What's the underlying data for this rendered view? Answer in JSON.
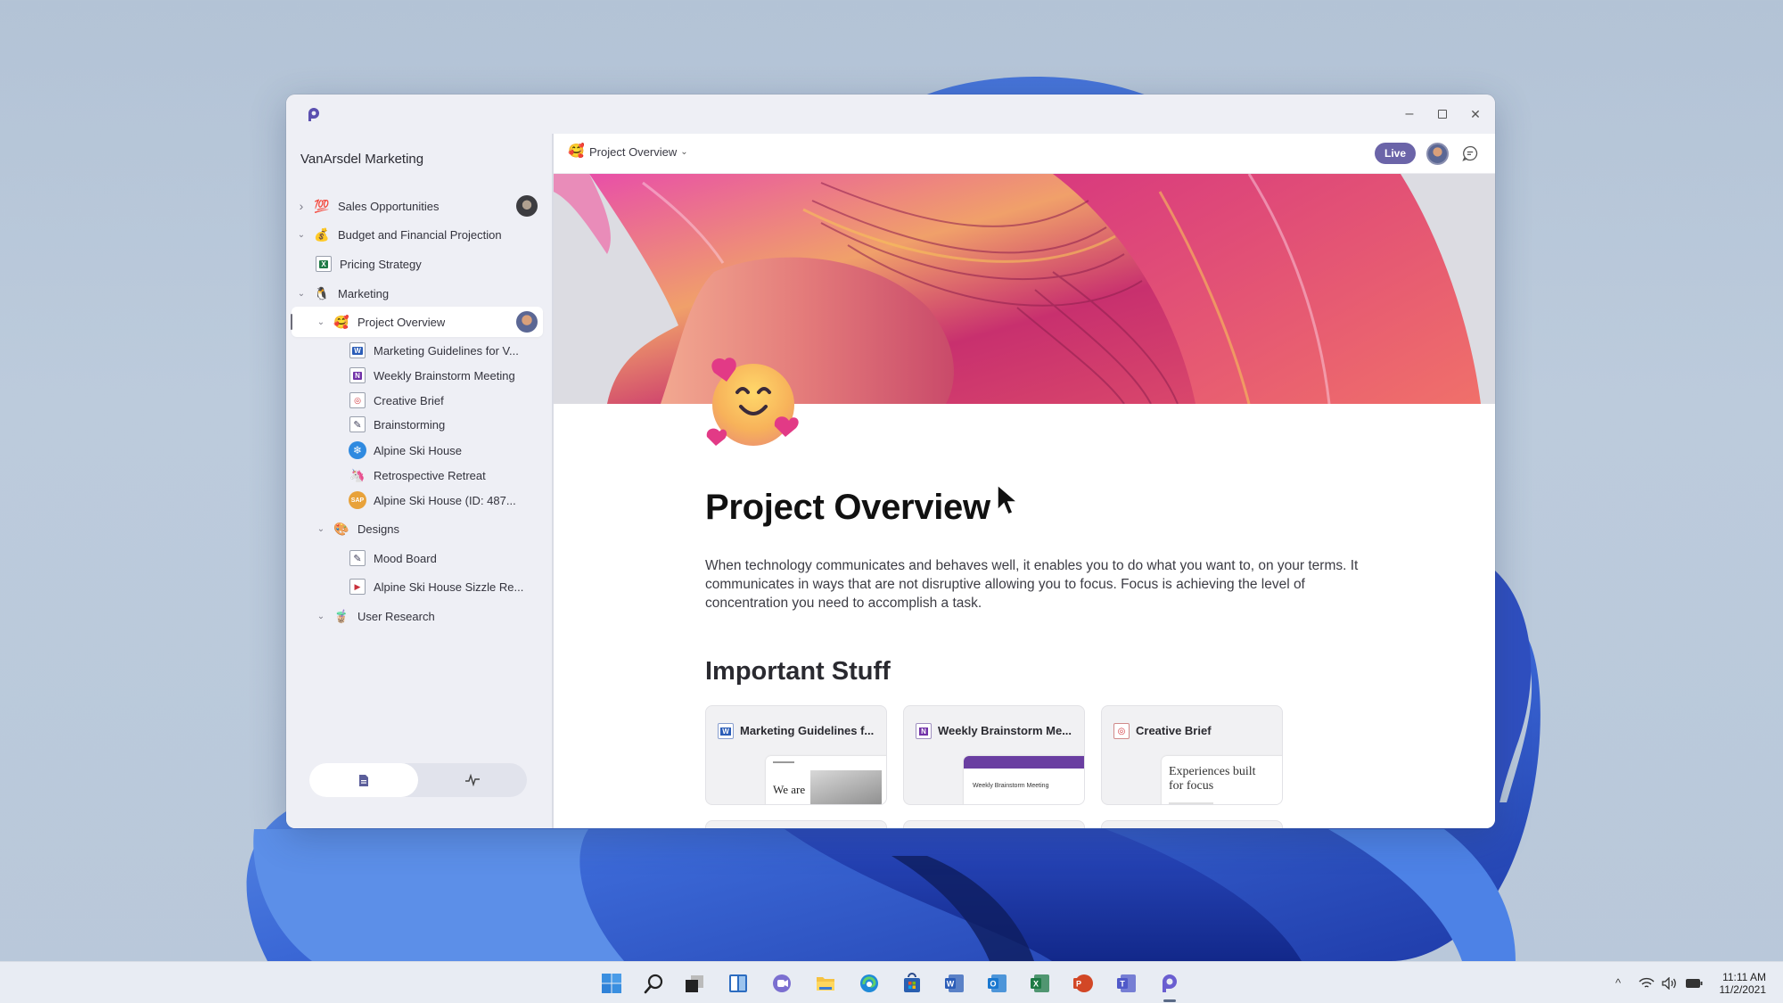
{
  "window": {
    "app_icon": "loop-app-icon",
    "controls": {
      "minimize": "–",
      "maximize": "□",
      "close": "✕"
    }
  },
  "sidebar": {
    "workspace_title": "VanArsdel Marketing",
    "items": [
      {
        "label": "Sales Opportunities",
        "icon": "hundred-points-emoji",
        "glyph": "💯",
        "chevron": "›",
        "expanded": false,
        "level": 0,
        "has_avatar": true
      },
      {
        "label": "Budget and Financial Projection",
        "icon": "money-bag-emoji",
        "glyph": "💰",
        "chevron": "⌄",
        "expanded": true,
        "level": 0
      },
      {
        "label": "Pricing Strategy",
        "icon": "excel-file-icon",
        "glyph": "X",
        "level": 1
      },
      {
        "label": "Marketing",
        "icon": "penguin-emoji",
        "glyph": "🐧",
        "chevron": "⌄",
        "expanded": true,
        "level": 0
      },
      {
        "label": "Project Overview",
        "icon": "smiling-hearts-emoji",
        "glyph": "🥰",
        "chevron": "⌄",
        "expanded": true,
        "level": 1,
        "selected": true,
        "has_avatar": true
      },
      {
        "label": "Marketing Guidelines for V...",
        "icon": "word-file-icon",
        "glyph": "W",
        "level": 2
      },
      {
        "label": "Weekly Brainstorm Meeting",
        "icon": "onenote-file-icon",
        "glyph": "N",
        "level": 2
      },
      {
        "label": "Creative Brief",
        "icon": "pdf-file-icon",
        "glyph": "◎",
        "level": 2
      },
      {
        "label": "Brainstorming",
        "icon": "whiteboard-icon",
        "glyph": "✎",
        "level": 2
      },
      {
        "label": "Alpine Ski House",
        "icon": "snowflake-icon",
        "glyph": "❄",
        "level": 2
      },
      {
        "label": "Retrospective Retreat",
        "icon": "unicorn-emoji",
        "glyph": "🦄",
        "level": 2
      },
      {
        "label": "Alpine Ski House (ID: 487...",
        "icon": "sap-icon",
        "glyph": "SAP",
        "level": 2
      },
      {
        "label": "Designs",
        "icon": "palette-emoji",
        "glyph": "🎨",
        "chevron": "⌄",
        "expanded": true,
        "level": 1
      },
      {
        "label": "Mood Board",
        "icon": "whiteboard-icon",
        "glyph": "✎",
        "level": 2
      },
      {
        "label": "Alpine Ski House Sizzle Re...",
        "icon": "video-file-icon",
        "glyph": "▶",
        "level": 2
      },
      {
        "label": "User Research",
        "icon": "bubble-tea-emoji",
        "glyph": "🧋",
        "chevron": "⌄",
        "expanded": true,
        "level": 1
      }
    ],
    "segmented": [
      {
        "name": "pages",
        "icon": "document-icon",
        "active": true
      },
      {
        "name": "activity",
        "icon": "activity-pulse-icon",
        "active": false
      }
    ]
  },
  "main": {
    "breadcrumb": {
      "label": "Project Overview",
      "caret": "⌄"
    },
    "live_label": "Live",
    "page_title": "Project Overview",
    "paragraph": "When technology communicates and behaves well, it enables you to do what you want to, on your terms. It communicates in ways that are not disruptive allowing you to focus. Focus is achieving the level of concentration you need to accomplish a task.",
    "section_title": "Important Stuff",
    "cards": [
      {
        "title": "Marketing Guidelines f...",
        "icon": "word-file-icon",
        "thumb_text": "We are"
      },
      {
        "title": "Weekly Brainstorm Me...",
        "icon": "onenote-file-icon",
        "thumb_text": "Weekly Brainstorm Meeting"
      },
      {
        "title": "Creative Brief",
        "icon": "pdf-file-icon",
        "thumb_text": "Experiences built for focus"
      }
    ]
  },
  "taskbar": {
    "apps": [
      {
        "name": "start",
        "icon": "windows-start-icon"
      },
      {
        "name": "search",
        "icon": "search-icon"
      },
      {
        "name": "task-view",
        "icon": "task-view-icon"
      },
      {
        "name": "widgets",
        "icon": "widgets-icon"
      },
      {
        "name": "chat",
        "icon": "teams-chat-icon"
      },
      {
        "name": "file-explorer",
        "icon": "folder-icon"
      },
      {
        "name": "edge",
        "icon": "edge-browser-icon"
      },
      {
        "name": "store",
        "icon": "store-icon"
      },
      {
        "name": "word",
        "icon": "word-app-icon",
        "letter": "W"
      },
      {
        "name": "outlook",
        "icon": "outlook-app-icon",
        "letter": "O"
      },
      {
        "name": "excel",
        "icon": "excel-app-icon",
        "letter": "X"
      },
      {
        "name": "powerpoint",
        "icon": "powerpoint-app-icon",
        "letter": "P"
      },
      {
        "name": "teams",
        "icon": "teams-app-icon",
        "letter": "T"
      },
      {
        "name": "loop",
        "icon": "loop-app-icon",
        "active": true
      }
    ],
    "tray": {
      "overflow": "^",
      "time": "11:11 AM",
      "date": "11/2/2021"
    }
  },
  "colors": {
    "accent_live": "#6b64a8",
    "onenote": "#7232a8",
    "word": "#2b5db8",
    "excel": "#1e7a45",
    "pdf": "#d1343b"
  }
}
